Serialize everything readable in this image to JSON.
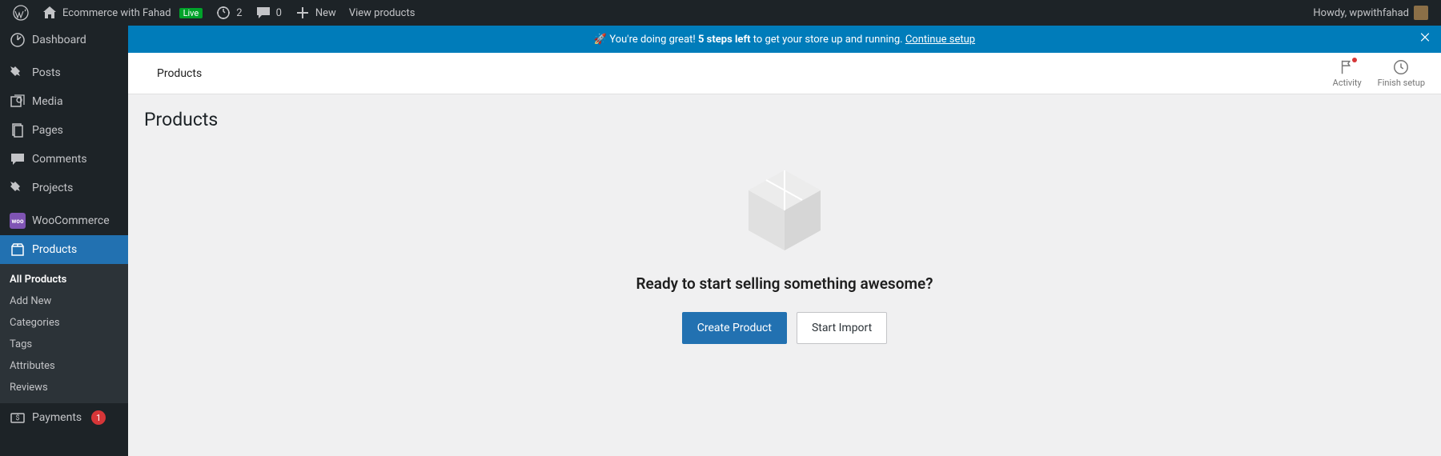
{
  "adminbar": {
    "site_name": "Ecommerce with Fahad",
    "live_label": "Live",
    "updates_count": "2",
    "comments_count": "0",
    "new_label": "New",
    "view_products_label": "View products",
    "howdy_prefix": "Howdy, ",
    "username": "wpwithfahad"
  },
  "sidebar": {
    "items": [
      {
        "label": "Dashboard"
      },
      {
        "label": "Posts"
      },
      {
        "label": "Media"
      },
      {
        "label": "Pages"
      },
      {
        "label": "Comments"
      },
      {
        "label": "Projects"
      },
      {
        "label": "WooCommerce"
      },
      {
        "label": "Products"
      },
      {
        "label": "Payments",
        "badge": "1"
      }
    ],
    "submenu": [
      {
        "label": "All Products"
      },
      {
        "label": "Add New"
      },
      {
        "label": "Categories"
      },
      {
        "label": "Tags"
      },
      {
        "label": "Attributes"
      },
      {
        "label": "Reviews"
      }
    ]
  },
  "banner": {
    "emoji": "🚀",
    "text_before": "You're doing great! ",
    "bold": "5 steps left",
    "text_after": " to get your store up and running. ",
    "link": "Continue setup"
  },
  "header": {
    "title": "Products",
    "activity": "Activity",
    "finish_setup": "Finish setup"
  },
  "content": {
    "page_heading": "Products",
    "empty_heading": "Ready to start selling something awesome?",
    "create_btn": "Create Product",
    "import_btn": "Start Import"
  }
}
